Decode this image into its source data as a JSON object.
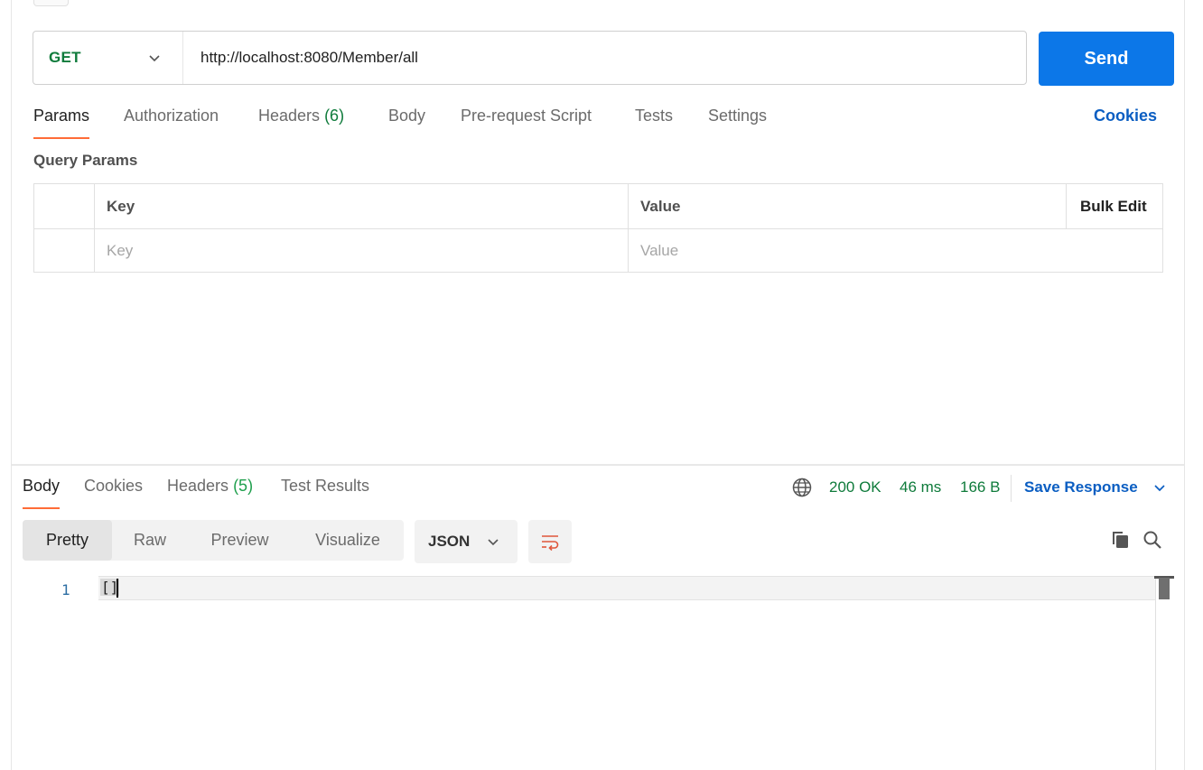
{
  "request": {
    "method": "GET",
    "url": "http://localhost:8080/Member/all",
    "send_label": "Send"
  },
  "request_tabs": [
    {
      "label": "Params",
      "active": true
    },
    {
      "label": "Authorization"
    },
    {
      "label": "Headers",
      "count": "(6)"
    },
    {
      "label": "Body"
    },
    {
      "label": "Pre-request Script"
    },
    {
      "label": "Tests"
    },
    {
      "label": "Settings"
    }
  ],
  "cookies_label": "Cookies",
  "query_params": {
    "title": "Query Params",
    "columns": {
      "key": "Key",
      "value": "Value",
      "bulk": "Bulk Edit"
    },
    "placeholders": {
      "key": "Key",
      "value": "Value"
    }
  },
  "response_tabs": [
    {
      "label": "Body",
      "active": true
    },
    {
      "label": "Cookies"
    },
    {
      "label": "Headers",
      "count": "(5)"
    },
    {
      "label": "Test Results"
    }
  ],
  "response_status": {
    "status": "200 OK",
    "time": "46 ms",
    "size": "166 B",
    "save_label": "Save Response"
  },
  "view_modes": [
    "Pretty",
    "Raw",
    "Preview",
    "Visualize"
  ],
  "format": "JSON",
  "editor": {
    "line_number": "1",
    "content": "[]"
  },
  "colors": {
    "send": "#0c77e8",
    "method_get": "#0f7b3b",
    "link_blue": "#0b5ec2",
    "tab_underline": "#ff6c37",
    "status_green": "#0f7b3b"
  },
  "icons": [
    "chevron-down-icon",
    "globe-icon",
    "wrap-lines-icon",
    "copy-icon",
    "search-icon"
  ]
}
